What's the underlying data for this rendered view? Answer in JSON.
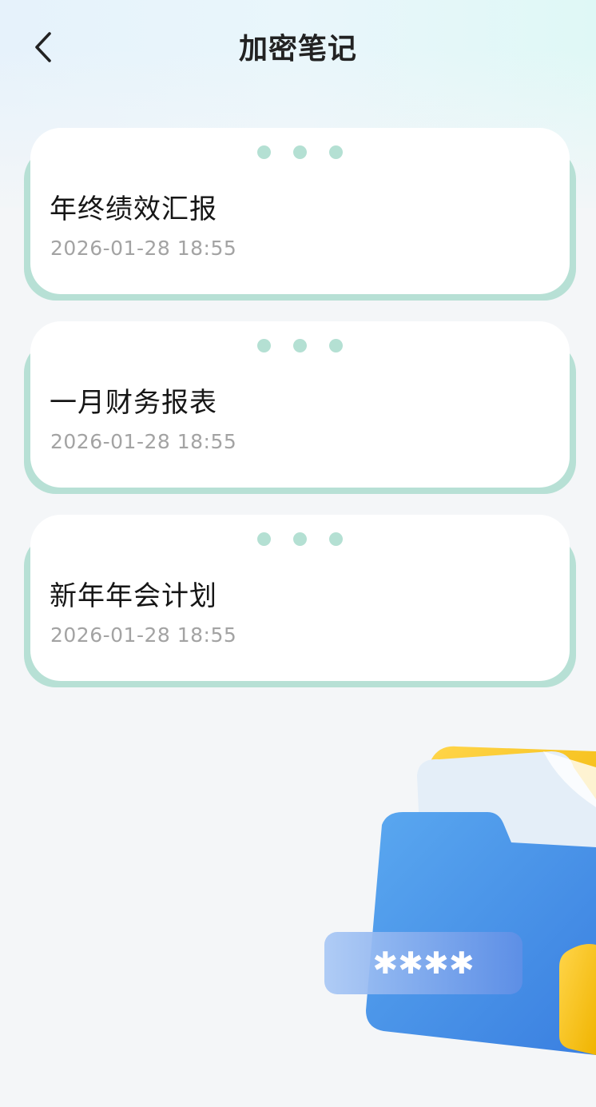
{
  "header": {
    "title": "加密笔记",
    "back_icon": "chevron-left-icon"
  },
  "notes": [
    {
      "title": "年终绩效汇报",
      "timestamp": "2026-01-28 18:55"
    },
    {
      "title": "一月财务报表",
      "timestamp": "2026-01-28 18:55"
    },
    {
      "title": "新年年会计划",
      "timestamp": "2026-01-28 18:55"
    }
  ],
  "colors": {
    "card_accent": "#b7e0d5",
    "dot": "#b4e0d3",
    "title_text": "#222222",
    "time_text": "#a3a3a3"
  },
  "illustration": {
    "icon": "encrypted-folder-illustration",
    "password_mask": "✱✱✱✱"
  }
}
